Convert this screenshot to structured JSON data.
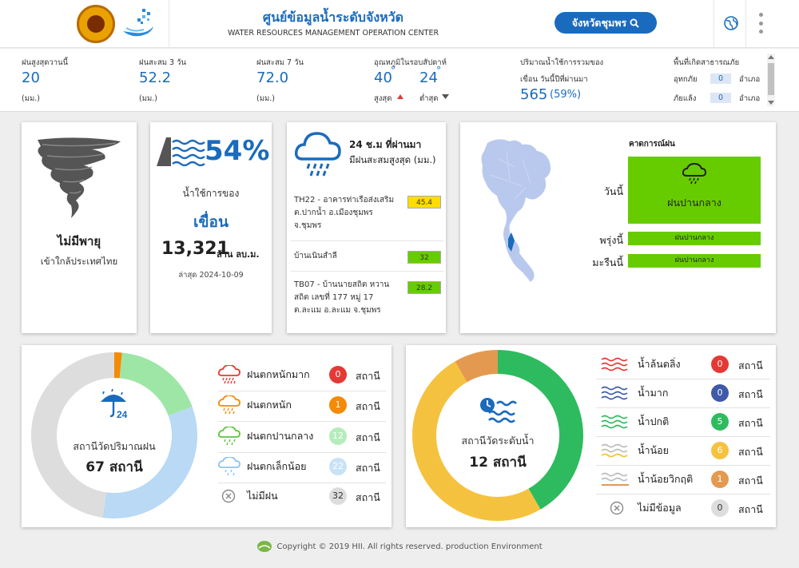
{
  "header": {
    "title_th": "ศูนย์ข้อมูลน้ำระดับจังหวัด",
    "title_en": "WATER RESOURCES MANAGEMENT OPERATION CENTER",
    "province_button": "จังหวัดชุมพร"
  },
  "stats": {
    "rain_today": {
      "label": "ฝนสูงสุดวานนี้",
      "value": "20",
      "unit": "(มม.)"
    },
    "rain_3d": {
      "label": "ฝนสะสม 3 วัน",
      "value": "52.2",
      "unit": "(มม.)"
    },
    "rain_7d": {
      "label": "ฝนสะสม 7 วัน",
      "value": "72.0",
      "unit": "(มม.)"
    },
    "temp": {
      "label": "อุณหภูมิในรอบสัปดาห์",
      "max": "40",
      "min": "24",
      "deg": "°",
      "max_label": "สูงสุด",
      "min_label": "ต่ำสุด"
    },
    "dam": {
      "label1": "ปริมาณน้ำใช้การรวมของ",
      "label2": "เขื่อน วันนี้ปีที่ผ่านมา",
      "value": "565",
      "pct": "(59%)"
    },
    "disaster": {
      "label": "พื้นที่เกิดสาธารณภัย",
      "flood_label": "อุทกภัย",
      "flood_value": "0",
      "drought_label": "ภัยแล้ง",
      "drought_value": "0",
      "unit": "อำเภอ"
    }
  },
  "storm": {
    "title": "ไม่มีพายุ",
    "subtitle": "เข้าใกล้ประเทศไทย"
  },
  "dam_card": {
    "pct": "54%",
    "label": "น้ำใช้การของ",
    "name": "เขื่อน",
    "value": "13,321",
    "unit": "ล้าน ลบ.ม.",
    "updated": "ล่าสุด 2024-10-09"
  },
  "rain24": {
    "title1": "24 ช.ม ที่ผ่านมา",
    "title2": "มีฝนสะสมสูงสุด (มม.)",
    "rows": [
      {
        "name": "TH22 - อาคารท่าเรือส่งเสริม ต.ปากน้ำ อ.เมืองชุมพร จ.ชุมพร",
        "value": "45.4",
        "color": "#ffdd00"
      },
      {
        "name": "บ้านเนินสำลี",
        "value": "32",
        "color": "#66cc00"
      },
      {
        "name": "TB07 - บ้านนายสถิต หวานสถิต เลขที่ 177 หมู่ 17 ต.ละแม อ.ละแม จ.ชุมพร",
        "value": "28.2",
        "color": "#66cc00"
      }
    ]
  },
  "forecast": {
    "title": "คาดการณ์ฝน",
    "today_label": "วันนี้",
    "today_value": "ฝนปานกลาง",
    "tomorrow_label": "พรุ่งนี้",
    "tomorrow_value": "ฝนปานกลาง",
    "next_label": "มะรืนนี้",
    "next_value": "ฝนปานกลาง",
    "color": "#66cc00"
  },
  "rain_stations": {
    "title": "สถานีวัดปริมาณฝน",
    "total": "67 สถานี",
    "unit": "สถานี",
    "items": [
      {
        "label": "ฝนตกหนักมาก",
        "count": 0,
        "color": "#e53935"
      },
      {
        "label": "ฝนตกหนัก",
        "count": 1,
        "color": "#f58a07"
      },
      {
        "label": "ฝนตกปานกลาง",
        "count": 12,
        "color": "#9ee6a6"
      },
      {
        "label": "ฝนตกเล็กน้อย",
        "count": 22,
        "color": "#b9d9f5"
      },
      {
        "label": "ไม่มีฝน",
        "count": 32,
        "color": "#dddddd"
      }
    ]
  },
  "water_stations": {
    "title": "สถานีวัดระดับน้ำ",
    "total": "12 สถานี",
    "unit": "สถานี",
    "items": [
      {
        "label": "น้ำล้นตลิ่ง",
        "count": 0,
        "color": "#e53935"
      },
      {
        "label": "น้ำมาก",
        "count": 0,
        "color": "#3f5aa8"
      },
      {
        "label": "น้ำปกติ",
        "count": 5,
        "color": "#2ebb5f"
      },
      {
        "label": "น้ำน้อย",
        "count": 6,
        "color": "#f5c240"
      },
      {
        "label": "น้ำน้อยวิกฤติ",
        "count": 1,
        "color": "#e39a50"
      },
      {
        "label": "ไม่มีข้อมูล",
        "count": 0,
        "color": "#dddddd"
      }
    ]
  },
  "footer": {
    "text": "Copyright © 2019 HII. All rights reserved. production Environment"
  }
}
